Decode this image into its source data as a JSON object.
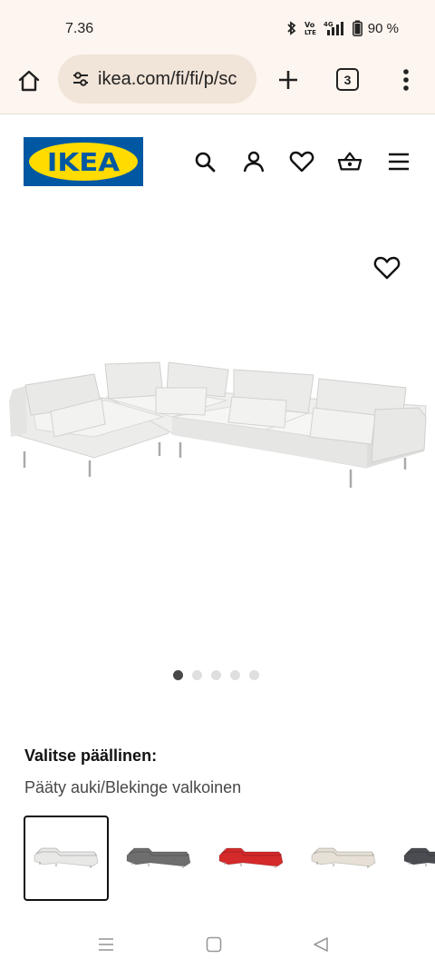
{
  "status_bar": {
    "time": "7.36",
    "battery": "90 %",
    "icons": [
      "bluetooth-icon",
      "volte-icon",
      "signal-4g-icon",
      "battery-icon"
    ]
  },
  "browser": {
    "url": "ikea.com/fi/fi/p/sc",
    "tab_count": "3",
    "icons": [
      "home-icon",
      "site-settings-icon",
      "plus-icon",
      "tab-switcher-icon",
      "more-vert-icon"
    ]
  },
  "header": {
    "logo_text": "IKEA",
    "icons": [
      "search-icon",
      "account-icon",
      "heart-icon",
      "basket-icon",
      "menu-icon"
    ]
  },
  "product": {
    "gallery_count": 5,
    "gallery_active": 0
  },
  "cover": {
    "heading": "Valitse päällinen:",
    "selected_value": "Pääty auki/Blekinge valkoinen",
    "swatch_colors": [
      "#e8e8e6",
      "#6e6e6e",
      "#d42a2a",
      "#e6e0d6",
      "#4a4c52"
    ]
  },
  "colors": {
    "ikea_blue": "#0058a3",
    "ikea_yellow": "#ffdb00",
    "chrome_bg": "#fdf5ef"
  }
}
